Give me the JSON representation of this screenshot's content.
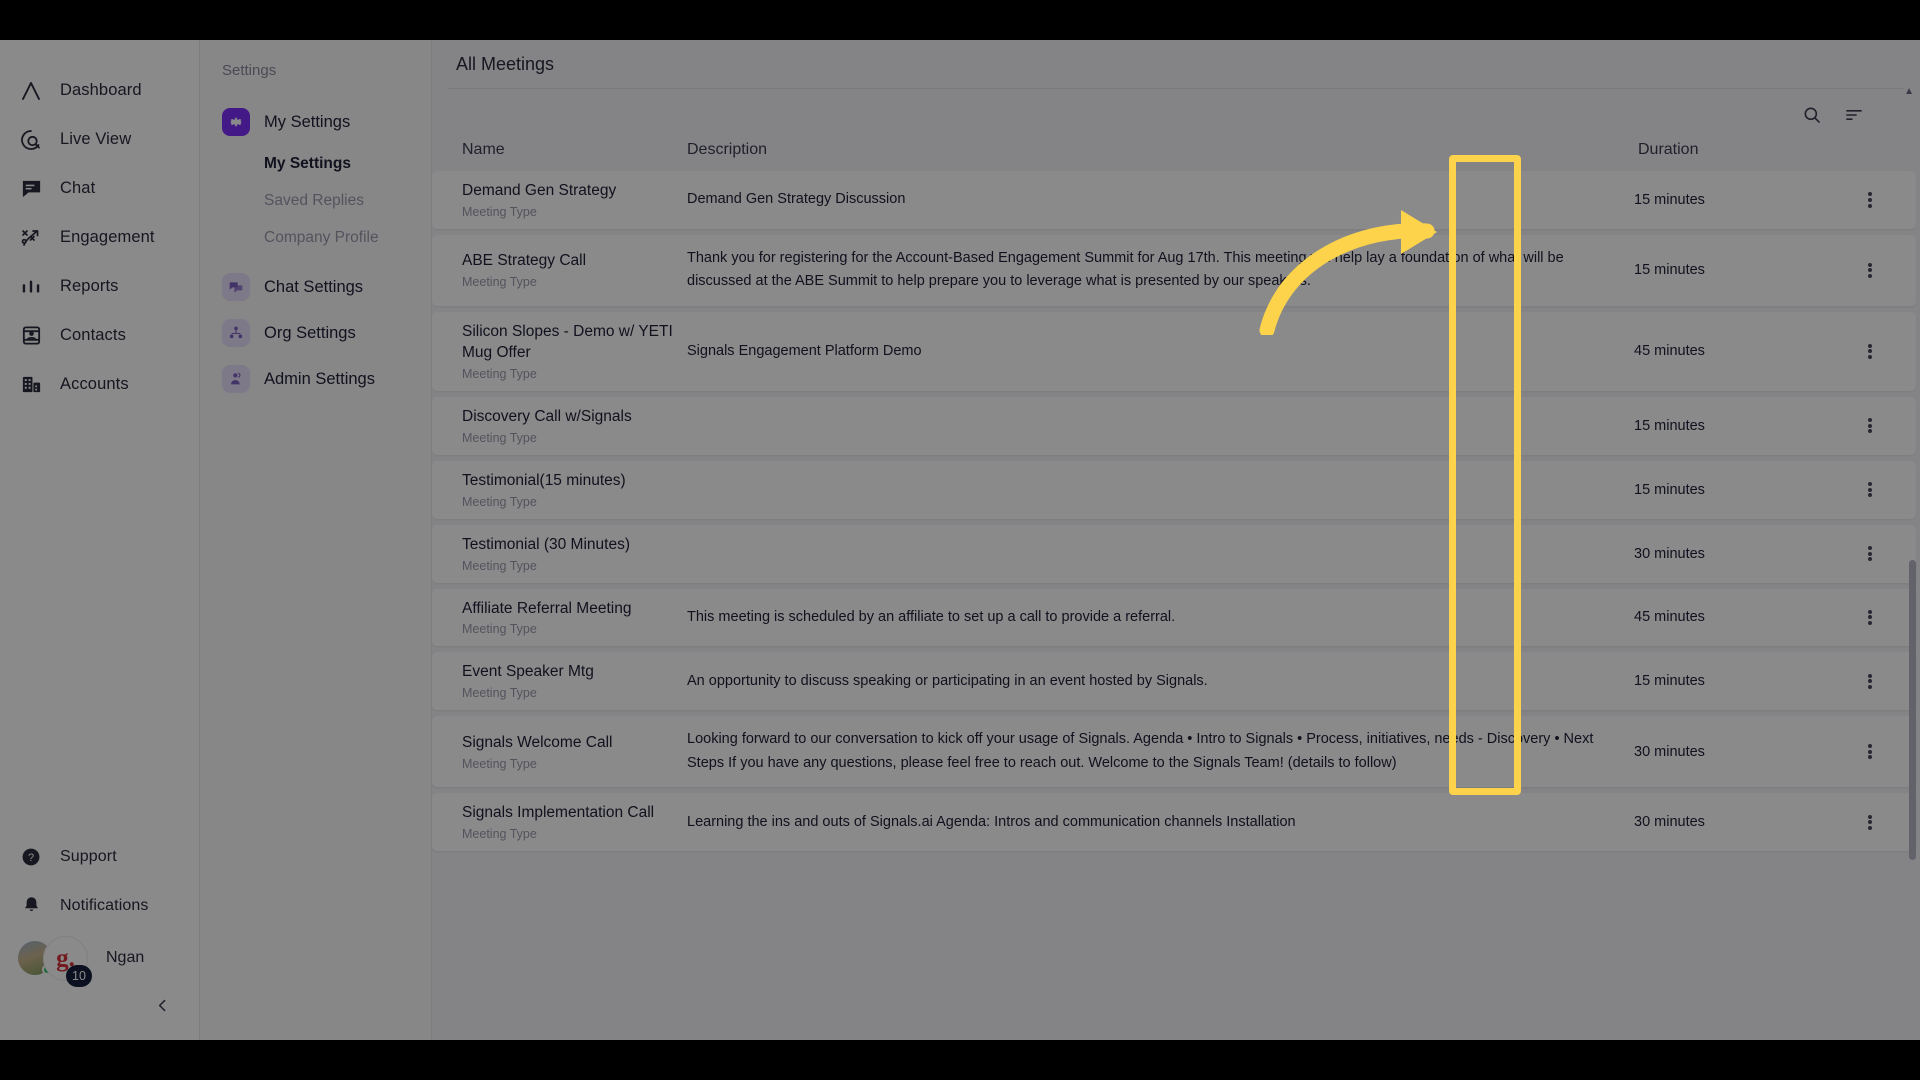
{
  "app": {
    "logo": "signals-logo",
    "nav": [
      {
        "label": "Dashboard",
        "icon": "dashboard-icon"
      },
      {
        "label": "Live View",
        "icon": "live-view-icon"
      },
      {
        "label": "Chat",
        "icon": "chat-icon"
      },
      {
        "label": "Engagement",
        "icon": "engagement-icon"
      },
      {
        "label": "Reports",
        "icon": "reports-icon"
      },
      {
        "label": "Contacts",
        "icon": "contacts-icon"
      },
      {
        "label": "Accounts",
        "icon": "accounts-icon"
      }
    ],
    "nav_bottom": [
      {
        "label": "Support",
        "icon": "help-circle-icon"
      },
      {
        "label": "Notifications",
        "icon": "bell-icon"
      }
    ],
    "profile": {
      "name": "Ngan",
      "badge_letter": "g.",
      "notification_count": "10",
      "avatar": "user-avatar",
      "status": "online"
    },
    "collapse_icon": "chevron-left-icon"
  },
  "settings": {
    "title": "Settings",
    "items": [
      {
        "label": "My Settings",
        "icon": "gear-icon",
        "active": true
      },
      {
        "label": "Chat Settings",
        "icon": "chat-bubbles-icon",
        "active": false
      },
      {
        "label": "Org Settings",
        "icon": "org-users-icon",
        "active": false
      },
      {
        "label": "Admin Settings",
        "icon": "admin-shield-icon",
        "active": false
      }
    ],
    "sub_items": [
      {
        "label": "My Settings",
        "selected": true
      },
      {
        "label": "Saved Replies",
        "selected": false
      },
      {
        "label": "Company Profile",
        "selected": false
      }
    ]
  },
  "main": {
    "title": "All Meetings",
    "toolbar": [
      {
        "name": "search-icon",
        "label": "Search"
      },
      {
        "name": "filter-icon",
        "label": "Filter"
      }
    ],
    "columns": {
      "name": "Name",
      "description": "Description",
      "duration": "Duration",
      "actions": ""
    },
    "row_subtitle": "Meeting Type",
    "rows": [
      {
        "name": "Demand Gen Strategy",
        "subtitle": "Meeting Type",
        "description": "Demand Gen Strategy Discussion",
        "duration": "15 minutes"
      },
      {
        "name": "ABE Strategy Call",
        "subtitle": "Meeting Type",
        "description": "Thank you for registering for the Account-Based Engagement Summit for Aug 17th. This meeting will help lay a foundation of what will be discussed at the ABE Summit to help prepare you to leverage what is presented by our speakers.",
        "duration": "15 minutes"
      },
      {
        "name": "Silicon Slopes - Demo w/ YETI Mug Offer",
        "subtitle": "Meeting Type",
        "description": "Signals Engagement Platform Demo",
        "duration": "45 minutes"
      },
      {
        "name": "Discovery Call w/Signals",
        "subtitle": "Meeting Type",
        "description": "",
        "duration": "15 minutes"
      },
      {
        "name": "Testimonial(15 minutes)",
        "subtitle": "Meeting Type",
        "description": "",
        "duration": "15 minutes"
      },
      {
        "name": "Testimonial (30 Minutes)",
        "subtitle": "Meeting Type",
        "description": "",
        "duration": "30 minutes"
      },
      {
        "name": "Affiliate Referral Meeting",
        "subtitle": "Meeting Type",
        "description": "This meeting is scheduled by an affiliate to set up a call to provide a referral.",
        "duration": "45 minutes"
      },
      {
        "name": "Event Speaker Mtg",
        "subtitle": "Meeting Type",
        "description": "An opportunity to discuss speaking or participating in an event hosted by Signals.",
        "duration": "15 minutes"
      },
      {
        "name": "Signals Welcome Call",
        "subtitle": "Meeting Type",
        "description": "Looking forward to our conversation to kick off your usage of Signals. Agenda • Intro to Signals • Process, initiatives, needs - Discovery • Next Steps If you have any questions, please feel free to reach out. Welcome to the Signals Team! (details to follow)",
        "duration": "30 minutes"
      },
      {
        "name": "Signals Implementation Call",
        "subtitle": "Meeting Type",
        "description": "Learning the ins and outs of Signals.ai Agenda: Intros and communication channels Installation",
        "duration": "30 minutes"
      }
    ],
    "row_action_icon": "kebab-menu-icon"
  },
  "annotation": {
    "color": "#fcd34a",
    "target": "row-actions-column",
    "arrow": "curved-arrow-right"
  }
}
